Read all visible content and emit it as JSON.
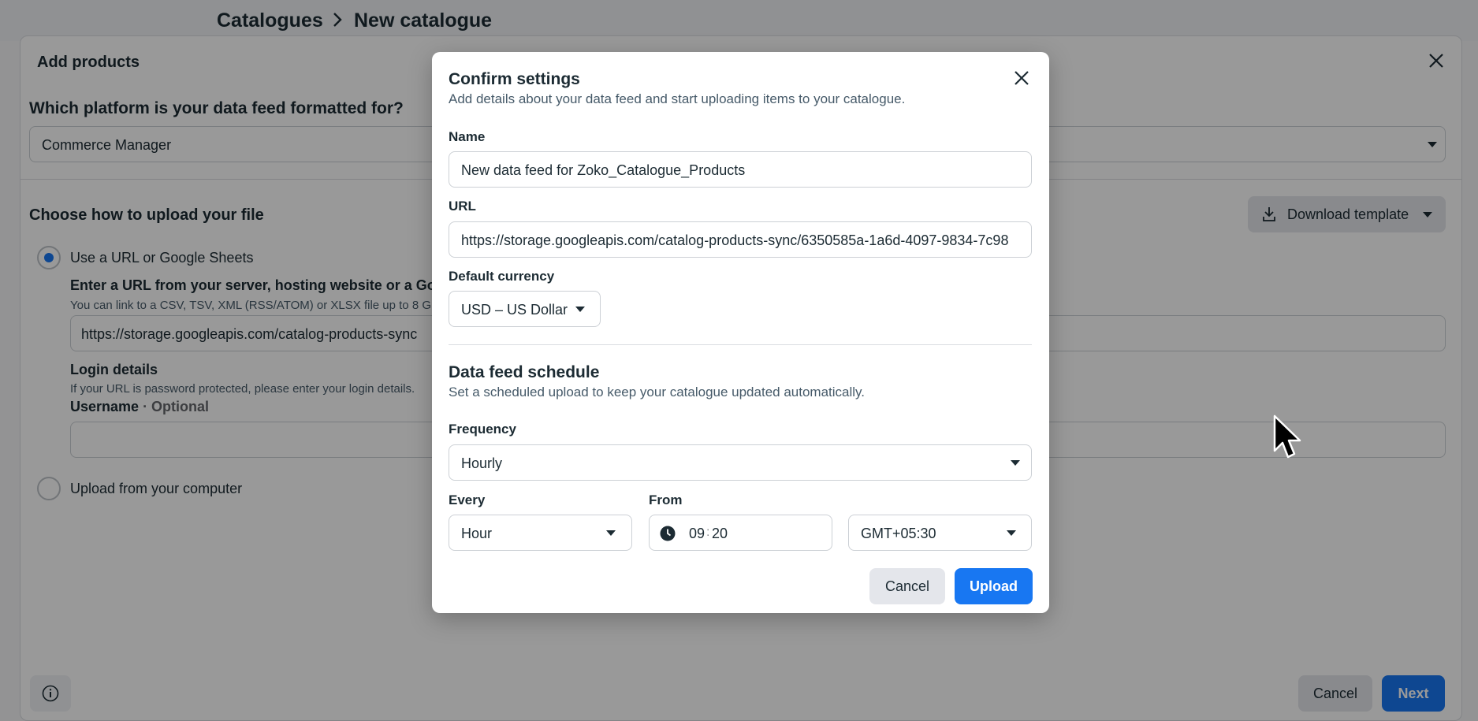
{
  "breadcrumb": {
    "parent": "Catalogues",
    "current": "New catalogue"
  },
  "add_products": {
    "title": "Add products",
    "platform_question": "Which platform is your data feed formatted for?",
    "platform_value": "Commerce Manager",
    "choose_title": "Choose how to upload your file",
    "download_template": "Download template",
    "option_url": "Use a URL or Google Sheets",
    "option_computer": "Upload from your computer",
    "enter_url_title": "Enter a URL from your server, hosting website or a Googl",
    "enter_url_sub": "You can link to a CSV, TSV, XML (RSS/ATOM) or XLSX file up to 8 G",
    "url_value": "https://storage.googleapis.com/catalog-products-sync",
    "login_title": "Login details",
    "login_sub": "If your URL is password protected, please enter your login details.",
    "username_label": "Username",
    "username_optional": "· Optional",
    "cancel": "Cancel",
    "next": "Next"
  },
  "modal": {
    "title": "Confirm settings",
    "subtitle": "Add details about your data feed and start uploading items to your catalogue.",
    "name_label": "Name",
    "name_value": "New data feed for Zoko_Catalogue_Products",
    "url_label": "URL",
    "url_value": "https://storage.googleapis.com/catalog-products-sync/6350585a-1a6d-4097-9834-7c98",
    "currency_label": "Default currency",
    "currency_value": "USD – US Dollar",
    "schedule_title": "Data feed schedule",
    "schedule_sub": "Set a scheduled upload to keep your catalogue updated automatically.",
    "frequency_label": "Frequency",
    "frequency_value": "Hourly",
    "every_label": "Every",
    "every_value": "Hour",
    "from_label": "From",
    "from_hour": "09",
    "from_colon": ":",
    "from_minute": "20",
    "timezone_value": "GMT+05:30",
    "cancel": "Cancel",
    "upload": "Upload"
  },
  "colors": {
    "primary": "#1877f2",
    "text": "#1c2b33",
    "secondary_button": "#e4e6eb"
  },
  "icons": [
    "chevron-right-icon",
    "close-icon",
    "download-icon",
    "info-icon",
    "clock-icon",
    "caret-down-icon",
    "mouse-pointer-icon"
  ]
}
